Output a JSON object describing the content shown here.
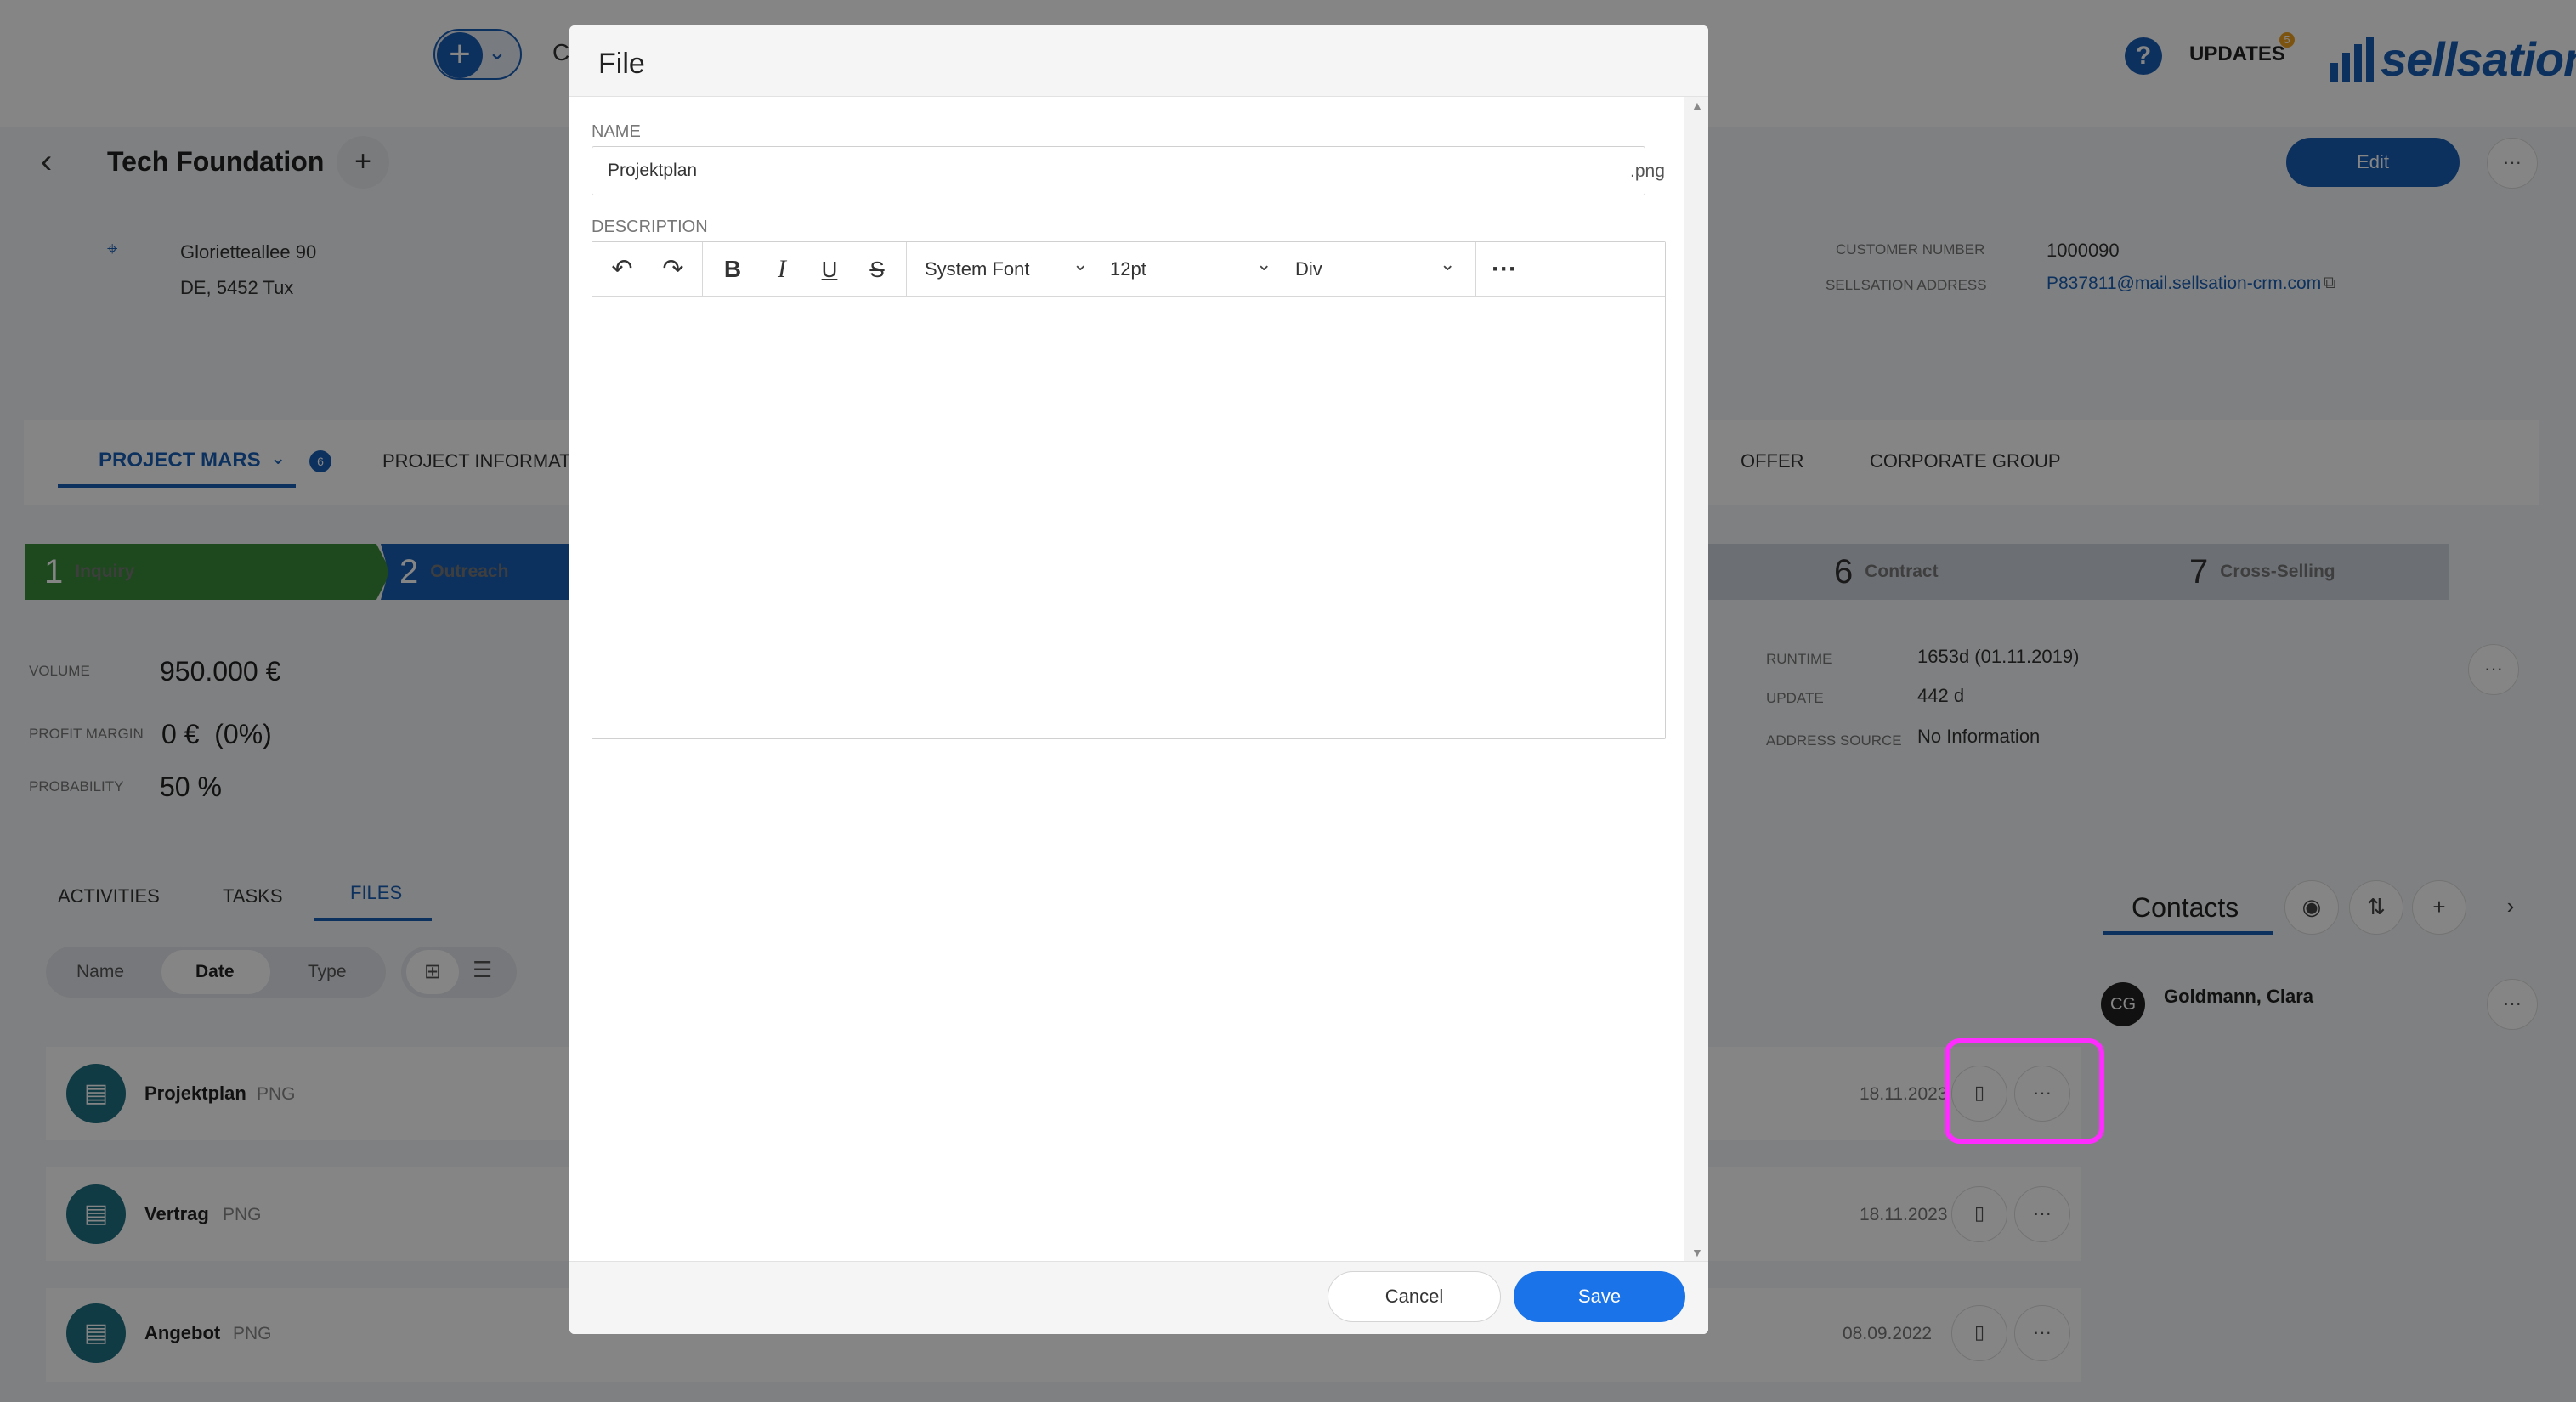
{
  "app": {
    "nav_partial": "C",
    "updates_label": "UPDATES",
    "updates_count": "5",
    "help_label": "?",
    "logo_text": "sellsation",
    "brand_color": "#1a5fb4"
  },
  "company": {
    "name": "Tech Foundation",
    "address_line1": "Glorietteallee 90",
    "address_line2": "DE, 5452 Tux",
    "customer_number_label": "CUSTOMER NUMBER",
    "customer_number": "1000090",
    "sellsation_address_label": "SELLSATION ADDRESS",
    "sellsation_address": "P837811@mail.sellsation-crm.com",
    "edit_label": "Edit"
  },
  "project_tabs": {
    "active": "PROJECT MARS",
    "active_badge": "6",
    "info": "PROJECT INFORMATI",
    "offer": "OFFER",
    "corporate_group": "CORPORATE GROUP"
  },
  "stages": [
    {
      "num": "1",
      "label": "Inquiry"
    },
    {
      "num": "2",
      "label": "Outreach"
    },
    {
      "num": "6",
      "label": "Contract"
    },
    {
      "num": "7",
      "label": "Cross-Selling"
    }
  ],
  "kpis": {
    "volume_label": "VOLUME",
    "volume": "950.000 €",
    "margin_label": "PROFIT MARGIN",
    "margin": "0 €  (0%)",
    "probability_label": "PROBABILITY",
    "probability": "50 %",
    "runtime_label": "RUNTIME",
    "runtime": "1653d (01.11.2019)",
    "update_label": "UPDATE",
    "update": "442 d",
    "source_label": "ADDRESS SOURCE",
    "source": "No Information"
  },
  "files_panel": {
    "tabs": [
      "ACTIVITIES",
      "TASKS",
      "FILES"
    ],
    "sort": [
      "Name",
      "Date",
      "Type"
    ],
    "files": [
      {
        "name": "Projektplan",
        "type": "PNG",
        "date": "18.11.2023"
      },
      {
        "name": "Vertrag",
        "type": "PNG",
        "date": "18.11.2023"
      },
      {
        "name": "Angebot",
        "type": "PNG",
        "date": "08.09.2022"
      }
    ]
  },
  "contacts": {
    "title": "Contacts",
    "items": [
      {
        "initials": "CG",
        "name": "Goldmann, Clara"
      }
    ]
  },
  "dialog": {
    "title": "File",
    "name_label": "NAME",
    "name_value": "Projektplan",
    "extension": ".png",
    "description_label": "DESCRIPTION",
    "font_family": "System Font",
    "font_size": "12pt",
    "block_format": "Div",
    "cancel_label": "Cancel",
    "save_label": "Save"
  },
  "highlight_color": "#ff2cff"
}
